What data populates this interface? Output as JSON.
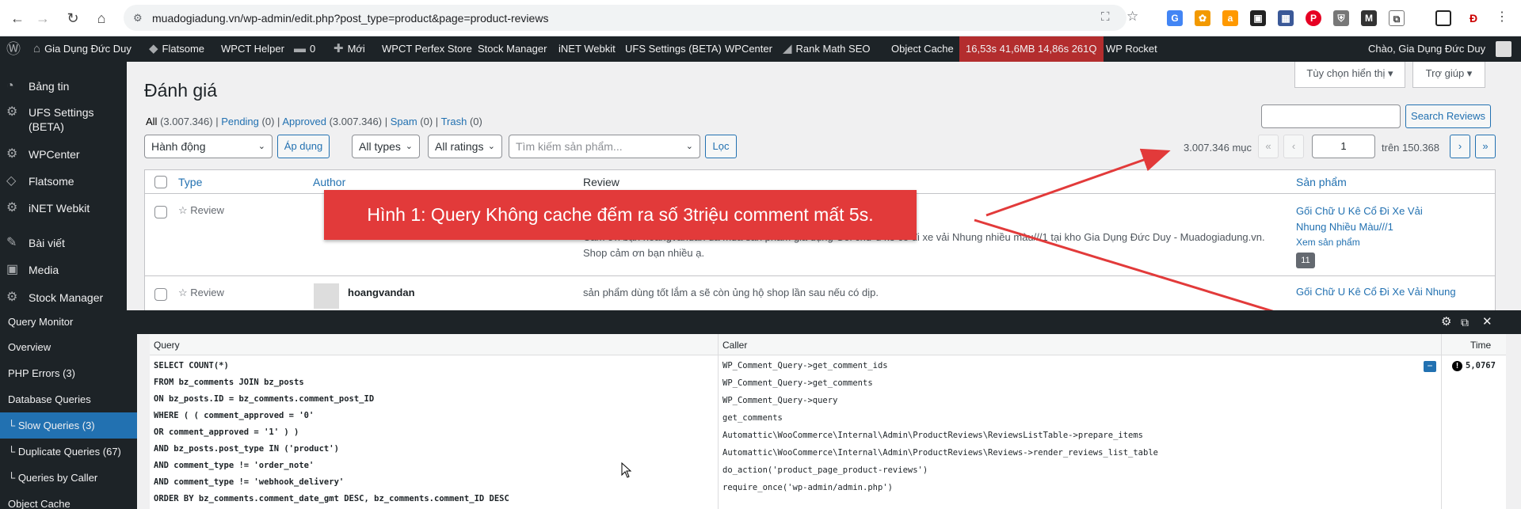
{
  "browser": {
    "url": "muadogiadung.vn/wp-admin/edit.php?post_type=product&page=product-reviews"
  },
  "adminbar": {
    "site_name": "Gia Dụng Đức Duy",
    "items": [
      "Flatsome",
      "WPCT Helper",
      "0",
      "Mới",
      "WPCT Perfex Store",
      "Stock Manager",
      "iNET Webkit",
      "UFS Settings (BETA)",
      "WPCenter",
      "Rank Math SEO",
      "Object Cache"
    ],
    "qm_stats": "16,53s  41,6MB  14,86s  261Q",
    "wp_rocket": "WP Rocket",
    "greeting": "Chào, Gia Dụng Đức Duy"
  },
  "sidebar": {
    "items": [
      {
        "label": "Bảng tin",
        "icon": "dashboard-icon"
      },
      {
        "label": "UFS Settings (BETA)",
        "icon": "gear-icon"
      },
      {
        "label": "WPCenter",
        "icon": "gear-icon"
      },
      {
        "label": "Flatsome",
        "icon": "flatsome-icon"
      },
      {
        "label": "iNET Webkit",
        "icon": "gear-icon"
      },
      {
        "label": "Bài viết",
        "icon": "pin-icon"
      },
      {
        "label": "Media",
        "icon": "media-icon"
      },
      {
        "label": "Stock Manager",
        "icon": "gear-icon"
      }
    ]
  },
  "page": {
    "title": "Đánh giá",
    "screen_options": "Tùy chọn hiển thị ▾",
    "help": "Trợ giúp ▾",
    "filters": {
      "all": "All",
      "all_count": "(3.007.346)",
      "pending": "Pending",
      "pending_count": "(0)",
      "approved": "Approved",
      "approved_count": "(3.007.346)",
      "spam": "Spam",
      "spam_count": "(0)",
      "trash": "Trash",
      "trash_count": "(0)"
    },
    "search_button": "Search Reviews",
    "bulk_action": "Hành động",
    "apply": "Áp dụng",
    "all_types": "All types",
    "all_ratings": "All ratings",
    "product_search_placeholder": "Tìm kiếm sản phẩm...",
    "filter_button": "Lọc",
    "items_count": "3.007.346 mục",
    "page_current": "1",
    "page_total": "trên 150.368"
  },
  "table": {
    "headers": {
      "type": "Type",
      "author": "Author",
      "review": "Review",
      "product": "Sản phẩm"
    },
    "rows": [
      {
        "type": "☆ Review",
        "review": "Cảm ơn bạn hoangvandan đã mua sản phẩm gia dụng Gối chữ u kê cổ đi xe vải Nhung nhiều màu///1 tại kho Gia Dụng Đức Duy - Muadogiadung.vn. Shop cảm ơn bạn nhiều ạ.",
        "product": "Gối Chữ U Kê Cổ Đi Xe Vải Nhung Nhiều Màu///1",
        "view_product": "Xem sản phẩm",
        "count": "11"
      },
      {
        "type": "☆ Review",
        "author": "hoangvandan",
        "review": "sản phẩm dùng tốt lắm a sẽ còn ủng hộ shop lần sau nếu có dịp.",
        "product": "Gối Chữ U Kê Cổ Đi Xe Vải Nhung"
      }
    ]
  },
  "annotation": "Hình 1: Query Không cache đếm ra số 3triệu comment mất 5s.",
  "query_monitor": {
    "title": "Query Monitor",
    "nav": [
      "Overview",
      "PHP Errors (3)",
      "Database Queries",
      "└ Slow Queries (3)",
      "└ Duplicate Queries (67)",
      "└ Queries by Caller",
      "Object Cache"
    ],
    "col_query": "Query",
    "col_caller": "Caller",
    "col_time": "Time",
    "query_lines": [
      "SELECT COUNT(*)",
      "FROM bz_comments JOIN bz_posts",
      "ON bz_posts.ID = bz_comments.comment_post_ID",
      "WHERE ( ( comment_approved = '0'",
      "OR comment_approved = '1' ) )",
      "AND bz_posts.post_type IN ('product')",
      "AND comment_type != 'order_note'",
      "AND comment_type != 'webhook_delivery'",
      "ORDER BY bz_comments.comment_date_gmt DESC, bz_comments.comment_ID DESC"
    ],
    "caller_lines": [
      "WP_Comment_Query->get_comment_ids",
      "WP_Comment_Query->get_comments",
      "WP_Comment_Query->query",
      "get_comments",
      "Automattic\\WooCommerce\\Internal\\Admin\\ProductReviews\\ReviewsListTable->prepare_items",
      "Automattic\\WooCommerce\\Internal\\Admin\\ProductReviews\\Reviews->render_reviews_list_table",
      "do_action('product_page_product-reviews')",
      "require_once('wp-admin/admin.php')"
    ],
    "time": "5,0767"
  }
}
